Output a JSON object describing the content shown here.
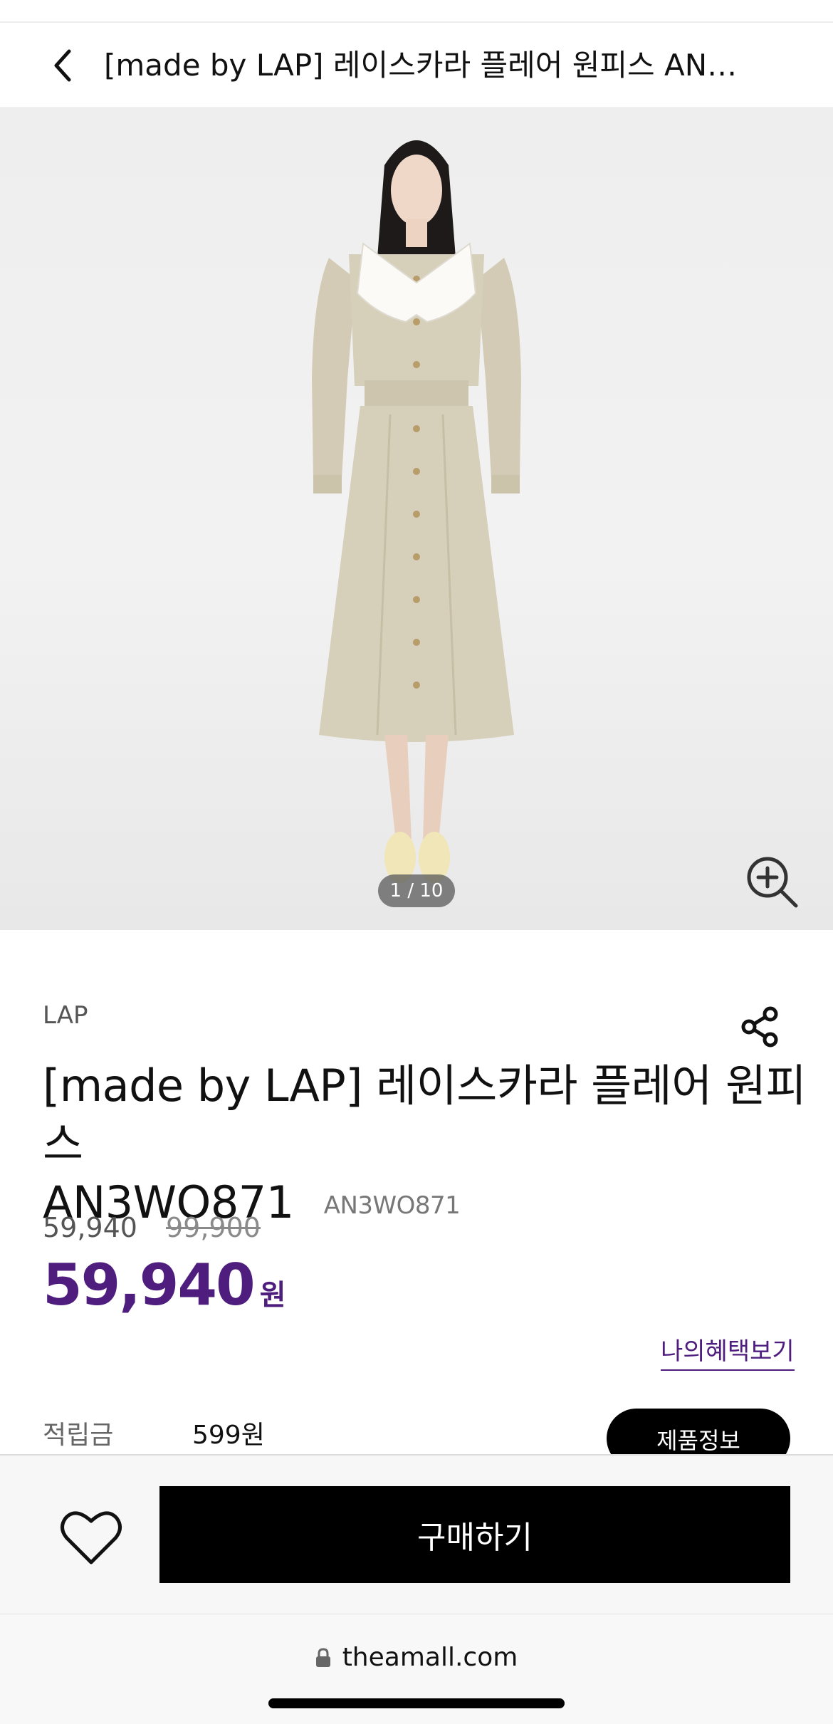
{
  "header": {
    "title": "[made by LAP] 레이스카라 플레어 원피스 AN3WO871"
  },
  "gallery": {
    "counter": "1 / 10"
  },
  "product": {
    "brand": "LAP",
    "name_line1": "[made by LAP] 레이스카라 플레어 원피스",
    "name_line2": "AN3WO871",
    "sku": "AN3WO871",
    "price_current": "59,940",
    "price_original": "99,900",
    "sale_price": "59,940",
    "sale_unit": "원",
    "benefit_link": "나의혜택보기",
    "points_label": "적립금",
    "points_value": "599원",
    "info_button": "제품정보"
  },
  "bottom_bar": {
    "buy_label": "구매하기"
  },
  "browser": {
    "url": "theamall.com"
  },
  "colors": {
    "accent": "#4e1d7e",
    "button": "#000000",
    "dress": "#d6cfba"
  },
  "icons": [
    "chevron-left-icon",
    "zoom-in-icon",
    "share-icon",
    "heart-icon",
    "lock-icon"
  ]
}
